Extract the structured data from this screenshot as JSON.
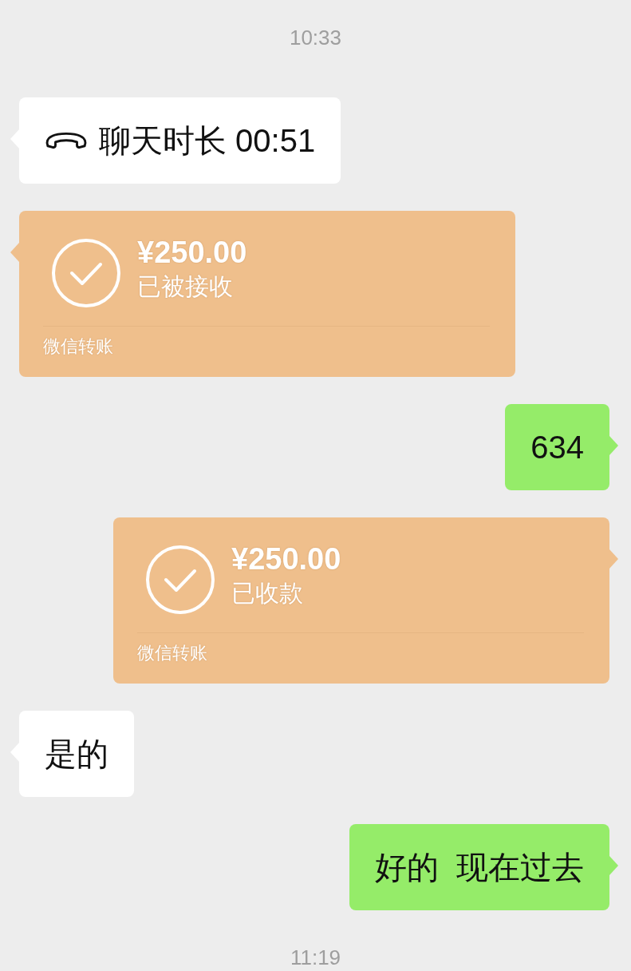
{
  "messages": [
    {
      "kind": "time",
      "text": "10:33"
    },
    {
      "kind": "call",
      "outgoing": false,
      "text": "聊天时长 00:51"
    },
    {
      "kind": "transfer",
      "outgoing": false,
      "amount": "¥250.00",
      "status": "已被接收",
      "label": "微信转账"
    },
    {
      "kind": "text",
      "outgoing": true,
      "text": "634"
    },
    {
      "kind": "transfer",
      "outgoing": true,
      "amount": "¥250.00",
      "status": "已收款",
      "label": "微信转账"
    },
    {
      "kind": "text",
      "outgoing": false,
      "text": "是的"
    },
    {
      "kind": "text",
      "outgoing": true,
      "text": "好的  现在过去"
    },
    {
      "kind": "time",
      "text": "11:19"
    }
  ]
}
